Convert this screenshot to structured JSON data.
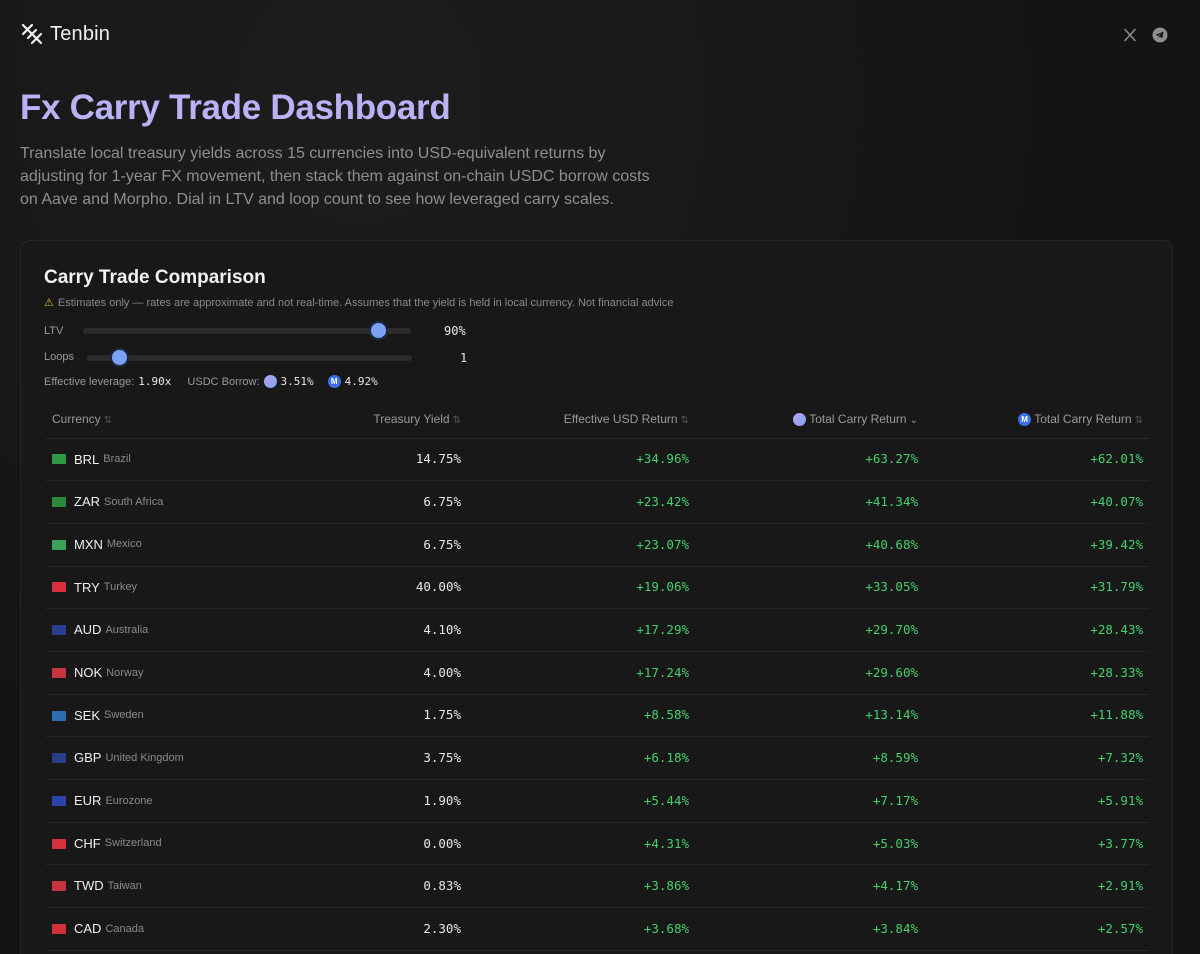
{
  "brand": {
    "name": "Tenbin",
    "logo_icon": "tenbin-logo-icon"
  },
  "social": {
    "x_icon": "x-icon",
    "telegram_icon": "telegram-icon"
  },
  "hero": {
    "title": "Fx Carry Trade Dashboard",
    "description": "Translate local treasury yields across 15 currencies into USD-equivalent returns by adjusting for 1-year FX movement, then stack them against on-chain USDC borrow costs on Aave and Morpho. Dial in LTV and loop count to see how leveraged carry scales."
  },
  "card": {
    "title": "Carry Trade Comparison",
    "warning": "Estimates only — rates are approximate and not real-time. Assumes that the yield is held in local currency. Not financial advice",
    "ltv": {
      "label": "LTV",
      "value": "90%",
      "fraction": 0.9
    },
    "loops": {
      "label": "Loops",
      "value": "1",
      "fraction": 0.1
    },
    "leverage_label": "Effective leverage:",
    "leverage_value": "1.90x",
    "borrow_label": "USDC Borrow:",
    "aave_borrow": "3.51%",
    "morpho_borrow": "4.92%"
  },
  "table": {
    "headers": {
      "currency": "Currency",
      "yield": "Treasury Yield",
      "effective": "Effective USD Return",
      "total_aave": "Total Carry Return",
      "total_morpho": "Total Carry Return"
    },
    "sort_icon": "⇅",
    "sort_active_icon": "⌄",
    "rows": [
      {
        "flag": "#2f9a45",
        "code": "BRL",
        "country": "Brazil",
        "yield": "14.75%",
        "eff": "+34.96%",
        "tc1": "+63.27%",
        "tc2": "+62.01%"
      },
      {
        "flag": "#2c8a3c",
        "code": "ZAR",
        "country": "South Africa",
        "yield": "6.75%",
        "eff": "+23.42%",
        "tc1": "+41.34%",
        "tc2": "+40.07%"
      },
      {
        "flag": "#3aa05a",
        "code": "MXN",
        "country": "Mexico",
        "yield": "6.75%",
        "eff": "+23.07%",
        "tc1": "+40.68%",
        "tc2": "+39.42%"
      },
      {
        "flag": "#d8313b",
        "code": "TRY",
        "country": "Turkey",
        "yield": "40.00%",
        "eff": "+19.06%",
        "tc1": "+33.05%",
        "tc2": "+31.79%"
      },
      {
        "flag": "#2a3f8f",
        "code": "AUD",
        "country": "Australia",
        "yield": "4.10%",
        "eff": "+17.29%",
        "tc1": "+29.70%",
        "tc2": "+28.43%"
      },
      {
        "flag": "#c8333d",
        "code": "NOK",
        "country": "Norway",
        "yield": "4.00%",
        "eff": "+17.24%",
        "tc1": "+29.60%",
        "tc2": "+28.33%"
      },
      {
        "flag": "#2e6db4",
        "code": "SEK",
        "country": "Sweden",
        "yield": "1.75%",
        "eff": "+8.58%",
        "tc1": "+13.14%",
        "tc2": "+11.88%"
      },
      {
        "flag": "#2a3d8a",
        "code": "GBP",
        "country": "United Kingdom",
        "yield": "3.75%",
        "eff": "+6.18%",
        "tc1": "+8.59%",
        "tc2": "+7.32%"
      },
      {
        "flag": "#2a44a8",
        "code": "EUR",
        "country": "Eurozone",
        "yield": "1.90%",
        "eff": "+5.44%",
        "tc1": "+7.17%",
        "tc2": "+5.91%"
      },
      {
        "flag": "#d6313a",
        "code": "CHF",
        "country": "Switzerland",
        "yield": "0.00%",
        "eff": "+4.31%",
        "tc1": "+5.03%",
        "tc2": "+3.77%"
      },
      {
        "flag": "#c8333d",
        "code": "TWD",
        "country": "Taiwan",
        "yield": "0.83%",
        "eff": "+3.86%",
        "tc1": "+4.17%",
        "tc2": "+2.91%"
      },
      {
        "flag": "#d0303a",
        "code": "CAD",
        "country": "Canada",
        "yield": "2.30%",
        "eff": "+3.68%",
        "tc1": "+3.84%",
        "tc2": "+2.57%"
      }
    ]
  }
}
